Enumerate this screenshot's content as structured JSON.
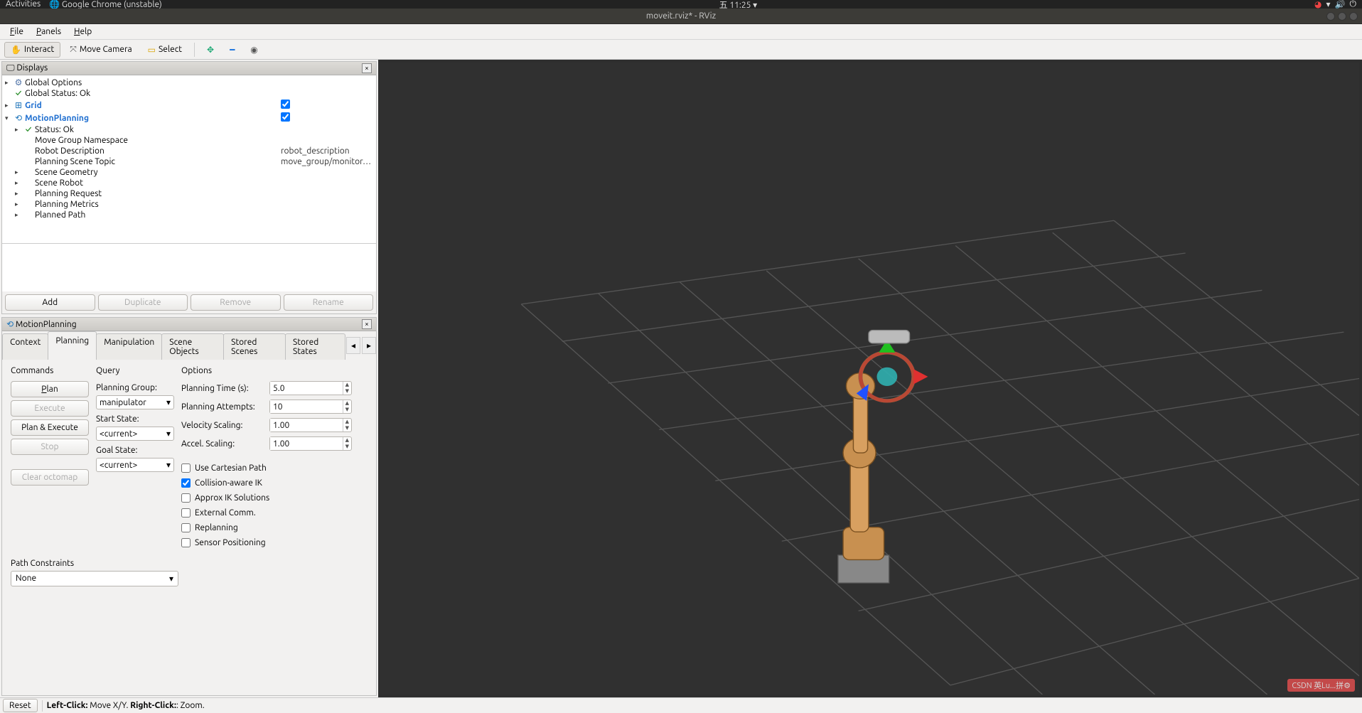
{
  "gnome": {
    "activities": "Activities",
    "app": "Google Chrome (unstable)",
    "clock": "11:25"
  },
  "window": {
    "title": "moveit.rviz* - RViz"
  },
  "menu": {
    "file": "File",
    "panels": "Panels",
    "help": "Help"
  },
  "toolbar": {
    "interact": "Interact",
    "move_camera": "Move Camera",
    "select": "Select"
  },
  "displays": {
    "title": "Displays",
    "global_options": "Global Options",
    "global_status": "Global Status: Ok",
    "grid": "Grid",
    "motion_planning": "MotionPlanning",
    "status_ok": "Status: Ok",
    "move_group_ns": "Move Group Namespace",
    "robot_desc": "Robot Description",
    "robot_desc_val": "robot_description",
    "planning_scene_topic": "Planning Scene Topic",
    "planning_scene_val": "move_group/monitor…",
    "scene_geometry": "Scene Geometry",
    "scene_robot": "Scene Robot",
    "planning_request": "Planning Request",
    "planning_metrics": "Planning Metrics",
    "planned_path": "Planned Path",
    "buttons": {
      "add": "Add",
      "duplicate": "Duplicate",
      "remove": "Remove",
      "rename": "Rename"
    }
  },
  "mp": {
    "title": "MotionPlanning",
    "tabs": {
      "context": "Context",
      "planning": "Planning",
      "manipulation": "Manipulation",
      "scene_objects": "Scene Objects",
      "stored_scenes": "Stored Scenes",
      "stored_states": "Stored States"
    },
    "commands": {
      "header": "Commands",
      "plan": "Plan",
      "execute": "Execute",
      "plan_execute": "Plan & Execute",
      "stop": "Stop",
      "clear_octomap": "Clear octomap"
    },
    "query": {
      "header": "Query",
      "planning_group": "Planning Group:",
      "planning_group_val": "manipulator",
      "start_state": "Start State:",
      "start_state_val": "<current>",
      "goal_state": "Goal State:",
      "goal_state_val": "<current>"
    },
    "options": {
      "header": "Options",
      "planning_time_label": "Planning Time (s):",
      "planning_time_val": "5.0",
      "planning_attempts_label": "Planning Attempts:",
      "planning_attempts_val": "10",
      "velocity_scaling_label": "Velocity Scaling:",
      "velocity_scaling_val": "1.00",
      "accel_scaling_label": "Accel. Scaling:",
      "accel_scaling_val": "1.00",
      "use_cartesian": "Use Cartesian Path",
      "collision_ik": "Collision-aware IK",
      "approx_ik": "Approx IK Solutions",
      "external_comm": "External Comm.",
      "replanning": "Replanning",
      "sensor_positioning": "Sensor Positioning"
    },
    "path_constraints": {
      "label": "Path Constraints",
      "value": "None"
    }
  },
  "status": {
    "reset": "Reset",
    "left_click": "Left-Click:",
    "left_click_text": " Move X/Y. ",
    "right_click": "Right-Click:",
    "right_click_text": ": Zoom."
  }
}
